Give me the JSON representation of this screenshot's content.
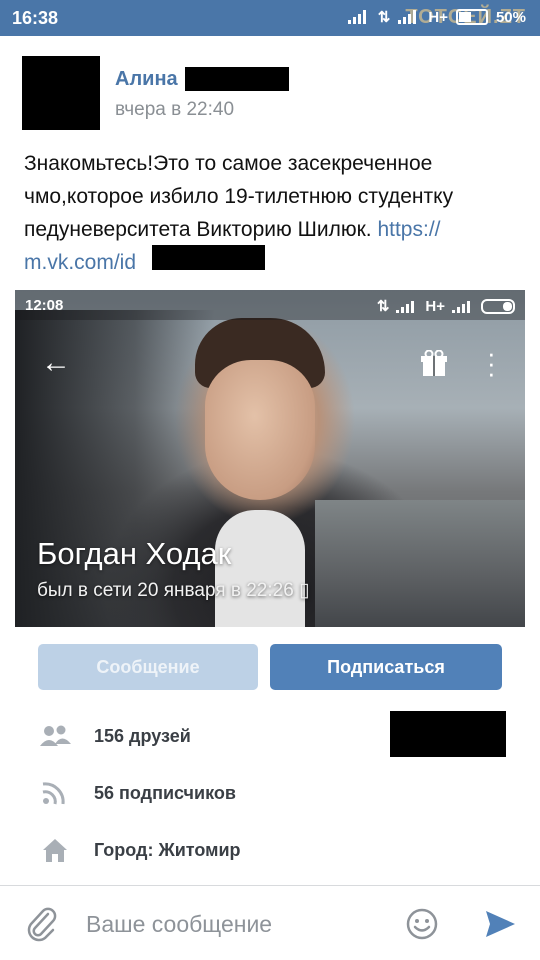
{
  "status_bar": {
    "time": "16:38",
    "network": "H+",
    "battery": "50%",
    "watermark": "ТОТСЕЙ.ZT"
  },
  "post": {
    "author": "Алина",
    "time": "вчера в 22:40",
    "text": "Знакомьтесь!Это то самое засекреченное чмо,которое избило 19-тилетнюю студентку педуневерситета Викторию Шилюк. ",
    "link": "https://\nm.vk.com/id"
  },
  "embedded": {
    "status_time": "12:08",
    "status_network": "H+",
    "profile_name": "Богдан Ходак",
    "last_seen": "был в сети 20 января в 22:26 ▯",
    "icons": [
      "back-arrow-icon",
      "gift-icon",
      "more-vertical-icon"
    ]
  },
  "buttons": {
    "message": "Сообщение",
    "subscribe": "Подписаться"
  },
  "info": {
    "friends": "156 друзей",
    "followers": "56 подписчиков",
    "city": "Город: Житомир"
  },
  "composer": {
    "placeholder": "Ваше сообщение"
  },
  "colors": {
    "vk_blue": "#4a76a8",
    "button_blue": "#5181b8",
    "button_disabled": "#bdd1e6"
  }
}
